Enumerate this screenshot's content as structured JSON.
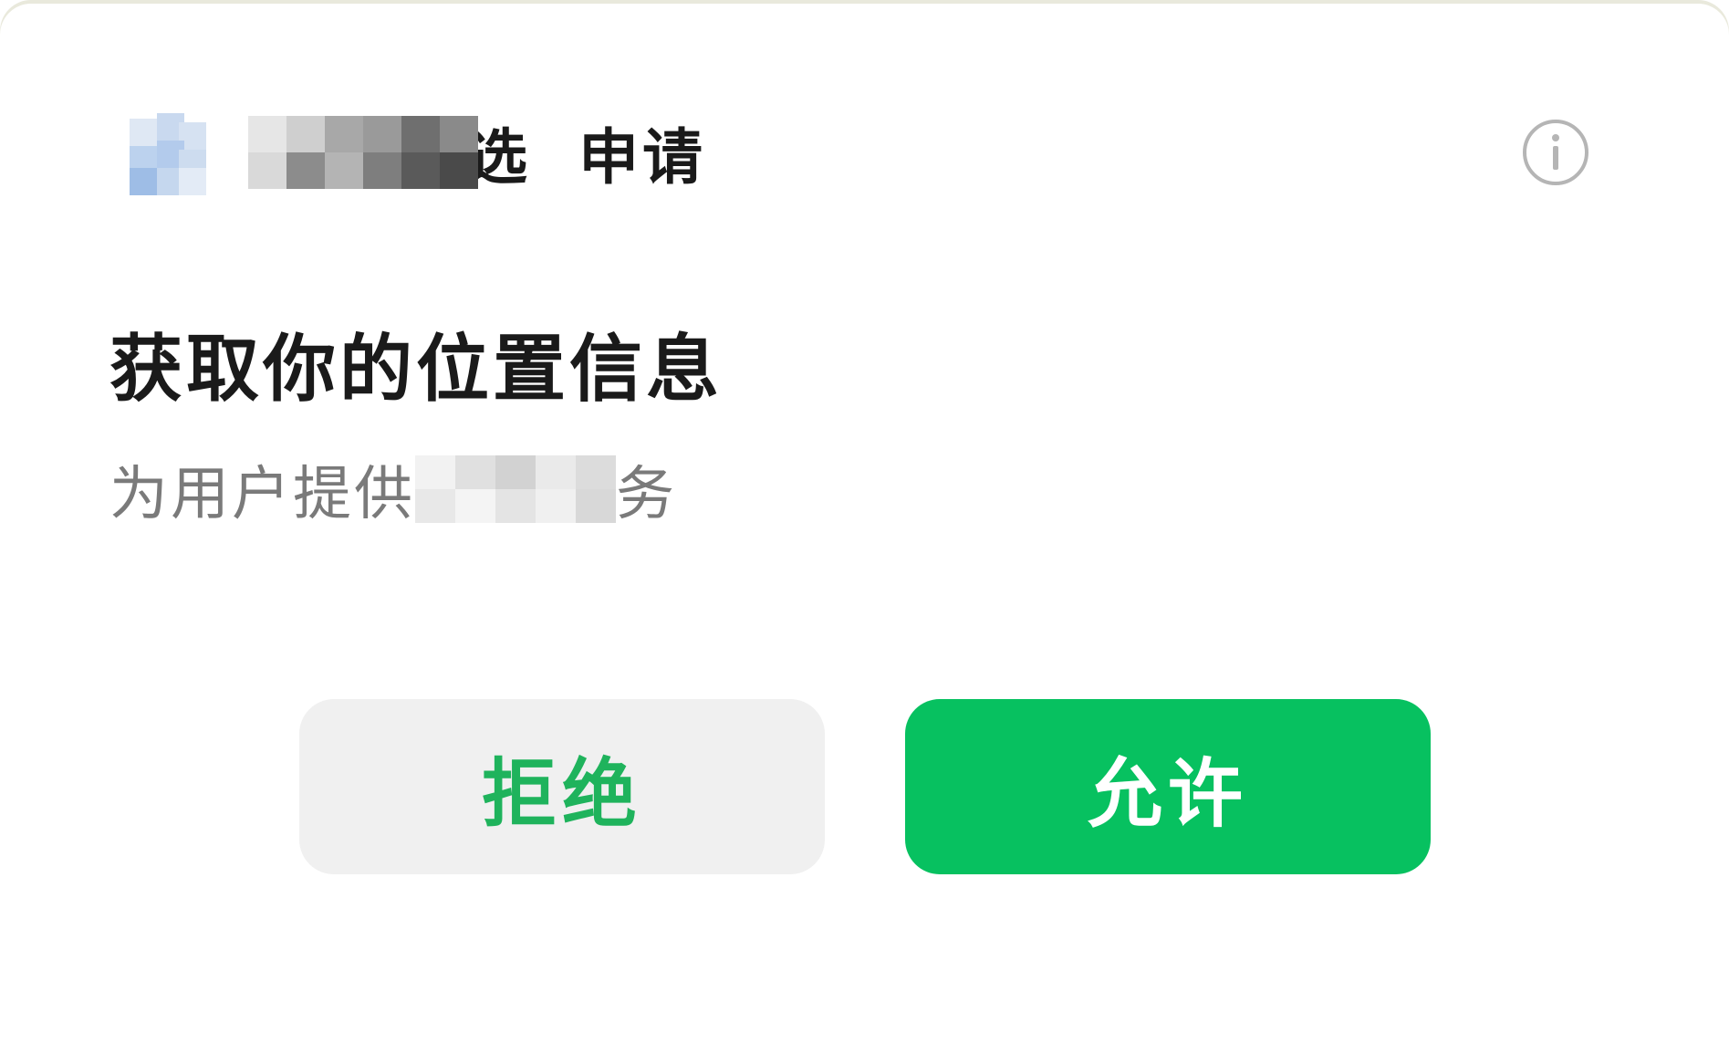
{
  "dialog": {
    "app_name_suffix": "选",
    "request_word": "申请",
    "title": "获取你的位置信息",
    "description_prefix": "为用户提供",
    "description_suffix": "务",
    "reject_label": "拒绝",
    "allow_label": "允许",
    "info_icon": "info-circle-icon",
    "colors": {
      "allow_bg": "#07c160",
      "reject_text": "#1fb35c",
      "reject_bg": "#f0f0f0",
      "title_text": "#1a1a1a",
      "description_text": "#7a7a7a"
    }
  }
}
